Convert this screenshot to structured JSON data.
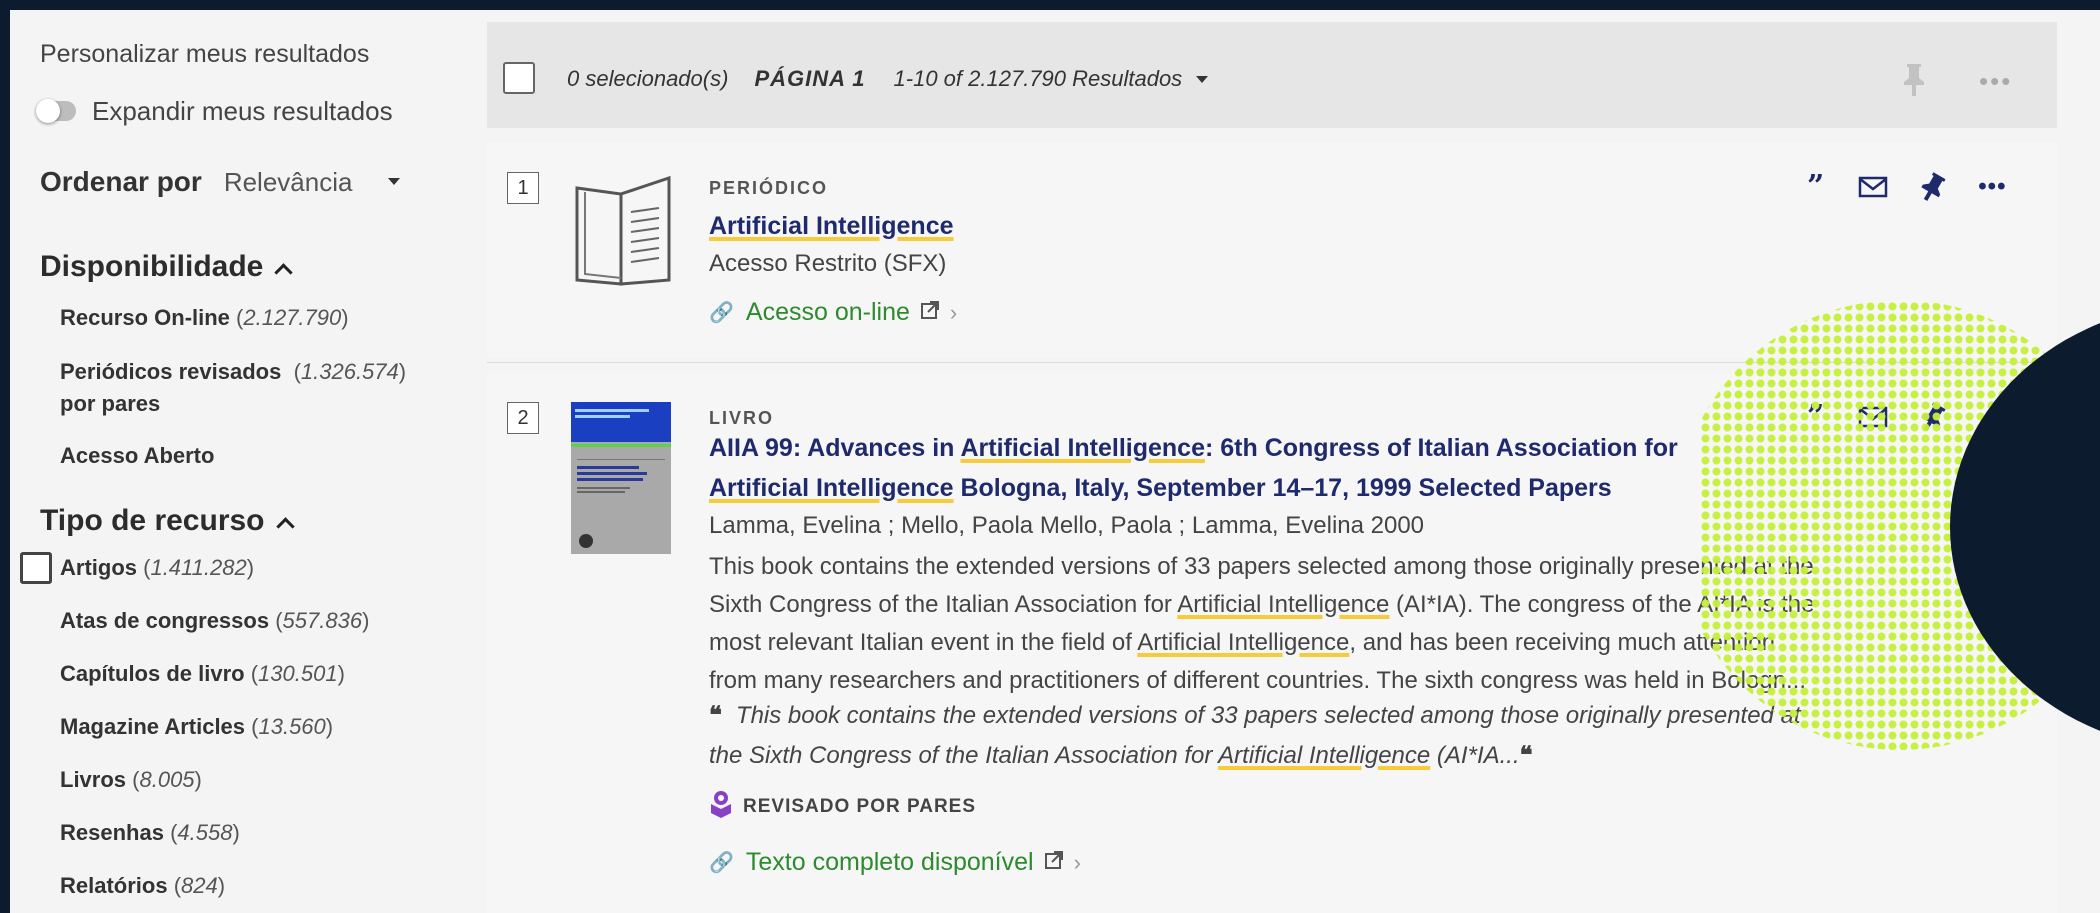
{
  "sidebar": {
    "personalize_title": "Personalizar meus resultados",
    "expand_label": "Expandir meus resultados",
    "sort_label": "Ordenar por",
    "sort_value": "Relevância",
    "availability": {
      "title": "Disponibilidade",
      "items": [
        {
          "label": "Recurso On-line",
          "count": "2.127.790"
        },
        {
          "label": "Periódicos revisados",
          "label2": "por pares",
          "count": "1.326.574"
        },
        {
          "label": "Acesso Aberto",
          "count": ""
        }
      ]
    },
    "resource_type": {
      "title": "Tipo de recurso",
      "items": [
        {
          "label": "Artigos",
          "count": "1.411.282"
        },
        {
          "label": "Atas de congressos",
          "count": "557.836"
        },
        {
          "label": "Capítulos de livro",
          "count": "130.501"
        },
        {
          "label": "Magazine Articles",
          "count": "13.560"
        },
        {
          "label": "Livros",
          "count": "8.005"
        },
        {
          "label": "Resenhas",
          "count": "4.558"
        },
        {
          "label": "Relatórios",
          "count": "824"
        }
      ]
    }
  },
  "topbar": {
    "selected": "0 selecionado(s)",
    "page": "PÁGINA 1",
    "results": "1-10 of 2.127.790 Resultados"
  },
  "results": [
    {
      "number": "1",
      "type": "PERIÓDICO",
      "title": "Artificial Intelligence",
      "access": "Acesso Restrito (SFX)",
      "link": "Acesso on-line"
    },
    {
      "number": "2",
      "type": "LIVRO",
      "title_parts": [
        "AIIA 99: Advances in ",
        "Artificial Intelligence",
        ": 6th Congress of Italian Association for"
      ],
      "title_line2_parts": [
        "Artificial Intelligence",
        " Bologna, Italy, September 14–17, 1999 Selected Papers"
      ],
      "authors": "Lamma, Evelina ; Mello, Paola Mello, Paola ; Lamma, Evelina 2000",
      "abstract_lines": [
        [
          "This book contains the extended versions of 33 papers selected among those originally presented at the"
        ],
        [
          "Sixth Congress of the Italian Association for ",
          "Artificial Intelligence",
          " (AI*IA). The congress of the AI*IA is the"
        ],
        [
          "most relevant Italian event in the field of ",
          "Artificial Intelligence",
          ", and has been receiving much attention"
        ],
        [
          "from many researchers and practitioners of different countries. The sixth congress was held in Bologn..."
        ]
      ],
      "snippet_lines": [
        [
          "This book contains the extended versions of 33 papers selected among those originally presented at"
        ],
        [
          "the Sixth Congress of the Italian Association for ",
          "Artificial Intelligence",
          " (AI*IA..."
        ]
      ],
      "peer_label": "REVISADO POR PARES",
      "link": "Texto completo disponível",
      "cover": {
        "series": "Lecture Notes in Artificial Intelligence 1792",
        "editors": "Evelina Lamma  Paola Mello (Eds.)",
        "title": "AI*IA 99: Advances in Artificial Intelligence",
        "publisher": "Springer"
      }
    }
  ],
  "colors": {
    "title_blue": "#1f2a6d",
    "link_green": "#2d8a2d",
    "highlight": "#f7cc3c",
    "deco_lime": "#c6f03a",
    "deco_navy": "#0c1b2e"
  },
  "icons": [
    "quote-icon",
    "mail-icon",
    "pin-icon",
    "more-icon",
    "external-link-icon",
    "chain-icon",
    "peer-review-icon"
  ]
}
